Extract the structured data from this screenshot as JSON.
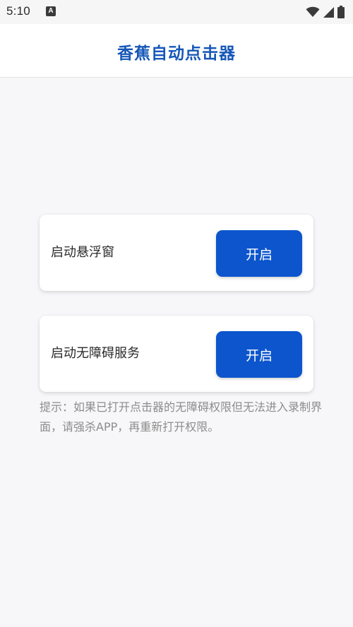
{
  "status_bar": {
    "time": "5:10",
    "app_icon_letter": "A",
    "icons": [
      "wifi-icon",
      "signal-icon",
      "battery-icon"
    ]
  },
  "app_bar": {
    "title": "香蕉自动点击器"
  },
  "cards": [
    {
      "label": "启动悬浮窗",
      "button_label": "开启"
    },
    {
      "label": "启动无障碍服务",
      "button_label": "开启"
    }
  ],
  "hint": "提示：如果已打开点击器的无障碍权限但无法进入录制界面，请强杀APP，再重新打开权限。",
  "colors": {
    "accent": "#0c55cd",
    "title": "#1657b8",
    "background": "#f7f7f9",
    "hint_text": "#8c8c8c"
  }
}
